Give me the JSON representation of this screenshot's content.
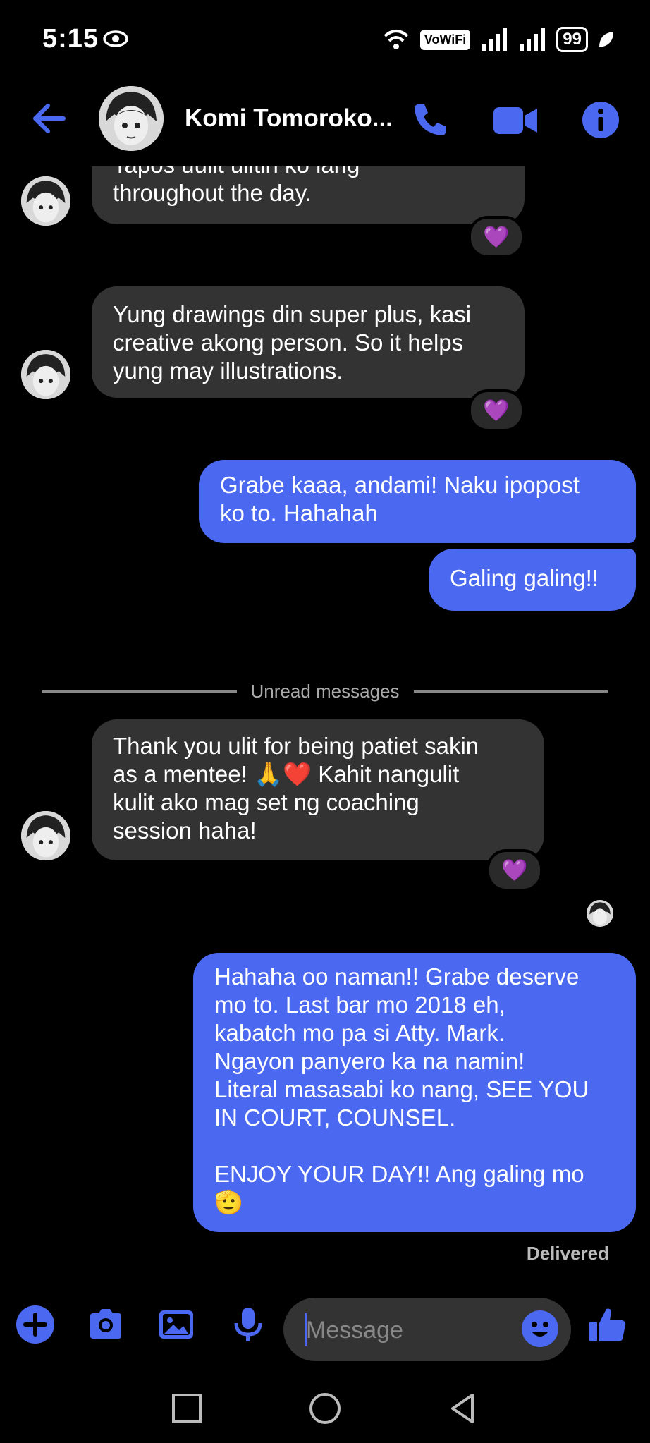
{
  "status_bar": {
    "time": "5:15",
    "network_badge": "VoWiFi",
    "battery": "99"
  },
  "header": {
    "contact_name": "Komi Tomoroko...",
    "accent_color": "#4a69f0"
  },
  "messages": [
    {
      "direction": "in",
      "text": "Tapos uulit ulitin ko lang\nthroughout the day.",
      "reaction": "💜"
    },
    {
      "direction": "in",
      "text": "Yung drawings din super plus, kasi\ncreative akong person. So it helps\nyung may illustrations.",
      "reaction": "💜"
    },
    {
      "direction": "out",
      "text": "Grabe kaaa, andami! Naku ipopost\nko to. Hahahah"
    },
    {
      "direction": "out",
      "text": "Galing galing!!"
    },
    {
      "direction": "in",
      "text": "Thank you ulit for being patiet sakin\nas a mentee! 🙏❤️ Kahit nangulit\nkulit ako mag set ng coaching\nsession haha!",
      "reaction": "💜"
    },
    {
      "direction": "out",
      "text": "Hahaha oo naman!! Grabe deserve\nmo to. Last bar mo 2018 eh,\nkabatch mo pa si Atty. Mark.\nNgayon panyero ka na namin!\nLiteral masasabi ko nang, SEE YOU\nIN COURT, COUNSEL.\n\nENJOY YOUR DAY!! Ang galing mo\n🫡"
    }
  ],
  "divider_label": "Unread messages",
  "delivered_label": "Delivered",
  "composer": {
    "placeholder": "Message"
  }
}
